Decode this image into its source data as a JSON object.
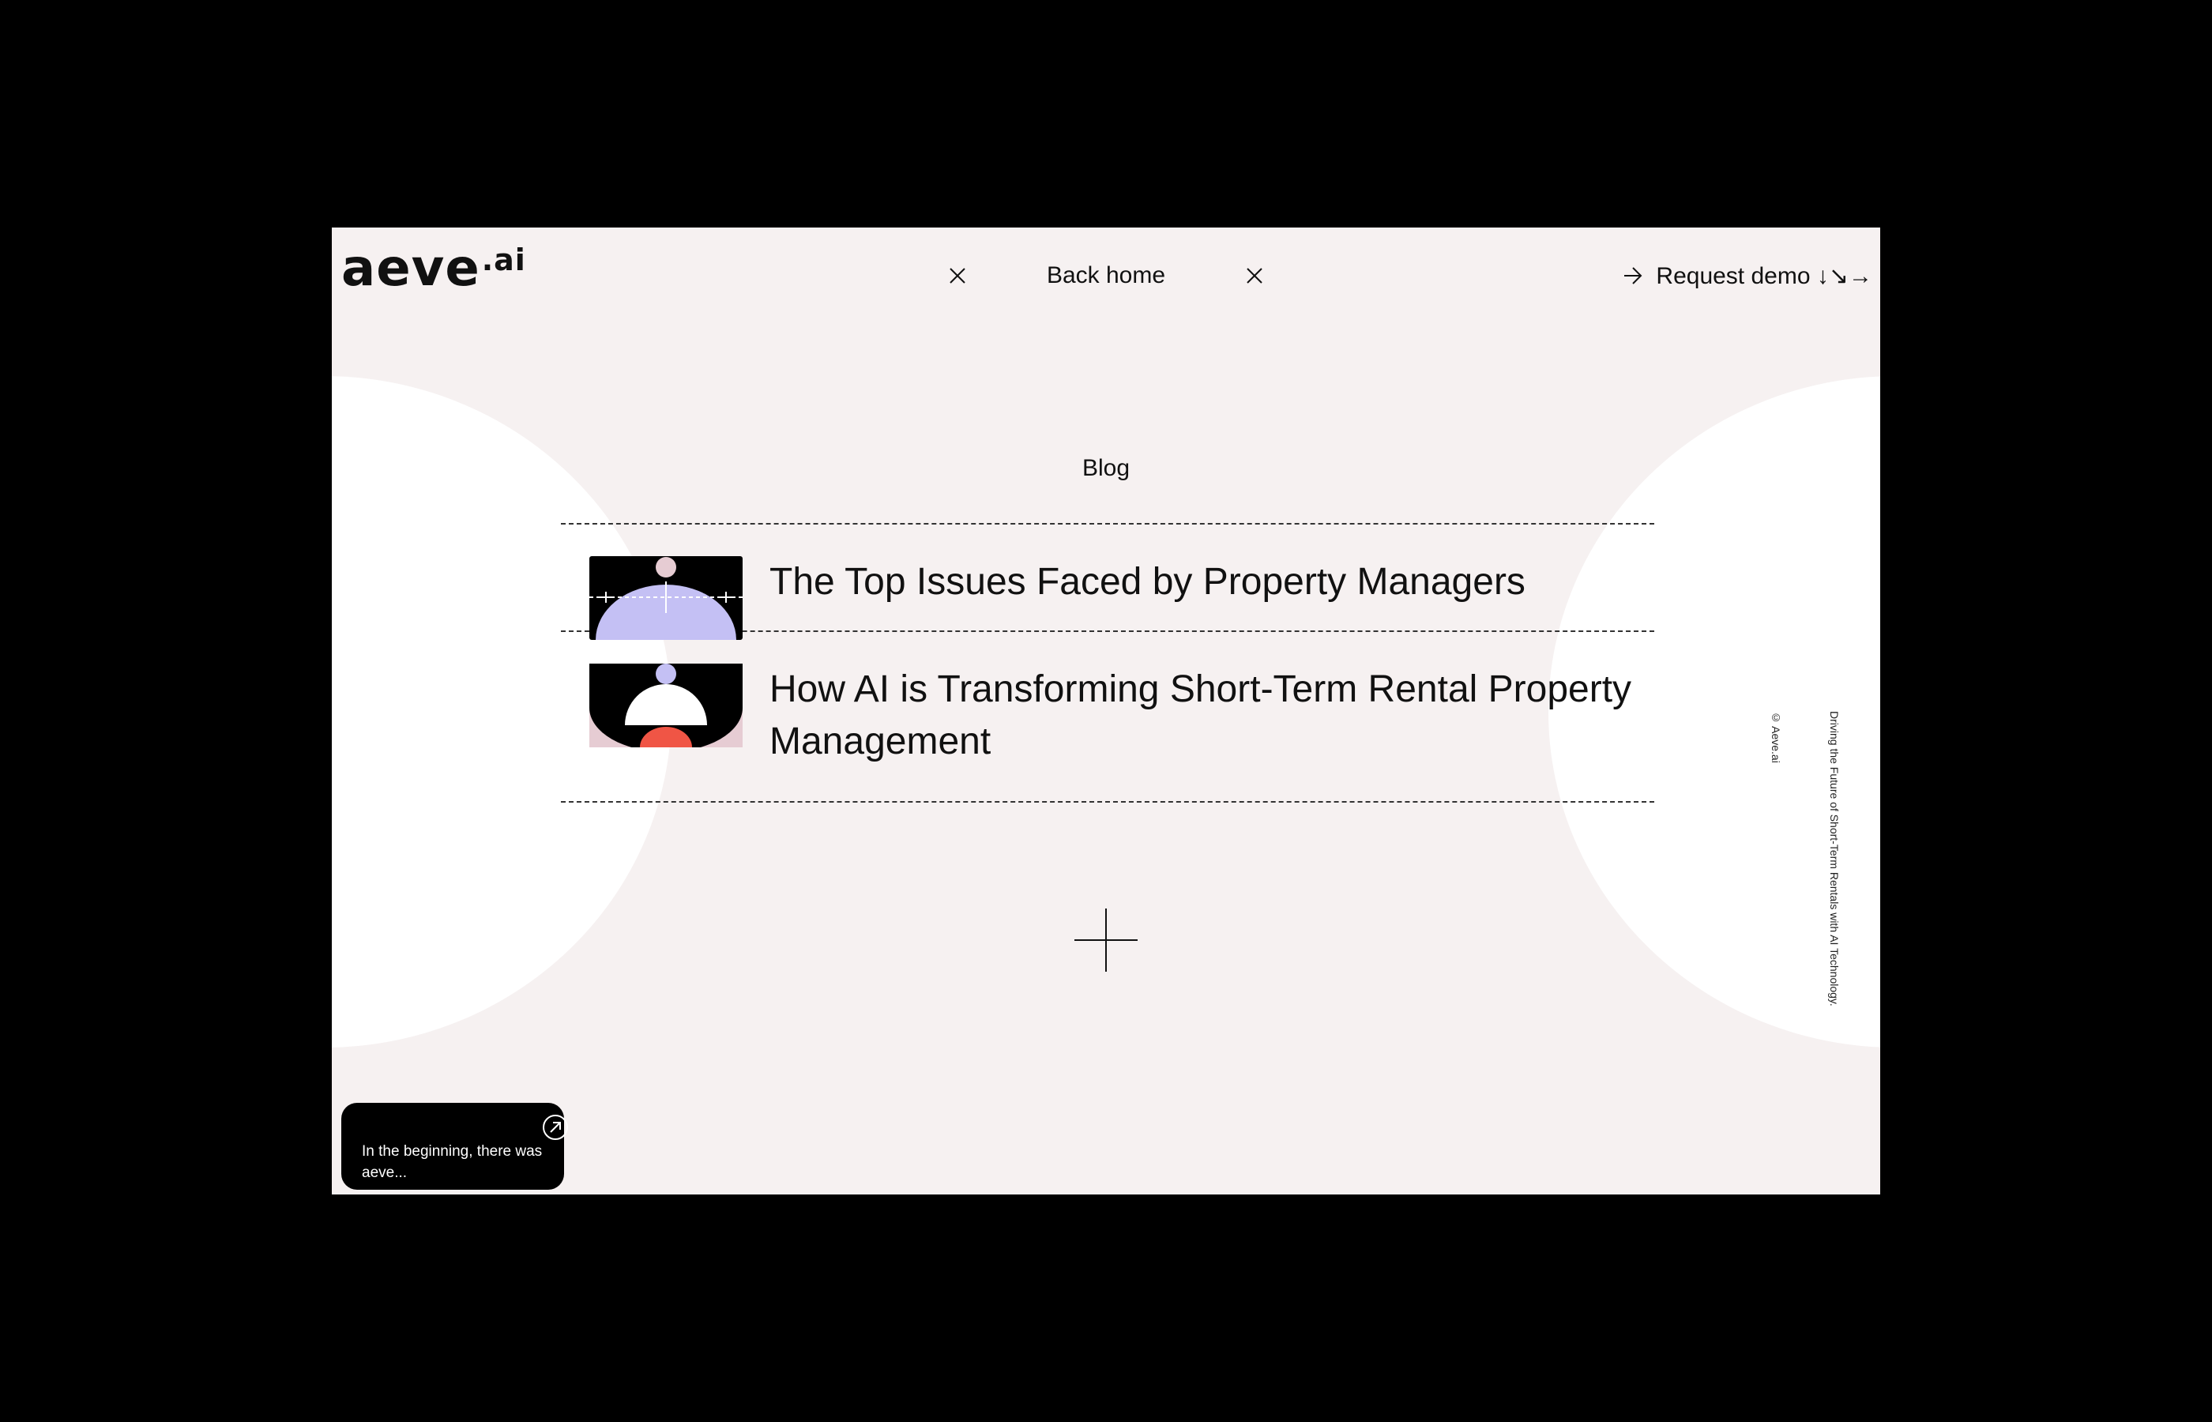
{
  "brand": {
    "name": "aeve",
    "suffix": ".ai"
  },
  "nav": {
    "back_home": "Back home",
    "request_demo": "Request demo ↓↘→"
  },
  "blog": {
    "heading": "Blog",
    "posts": [
      {
        "title": "The Top Issues Faced by Property Managers",
        "thumb_icon": "balance-scale-thumbnail"
      },
      {
        "title": "How AI is Transforming Short-Term Rental Property Management",
        "thumb_icon": "stacked-domes-thumbnail"
      }
    ]
  },
  "side": {
    "copyright": "© Aeve.ai",
    "tagline": "Driving the Future of Short-Term Rentals with AI Technology."
  },
  "card": {
    "text": "In the beginning, there was aeve..."
  },
  "colors": {
    "background": "#f6f1f1",
    "accent_lavender": "#c4c0f4",
    "accent_pink": "#e6ccd3",
    "accent_red": "#f05545"
  }
}
